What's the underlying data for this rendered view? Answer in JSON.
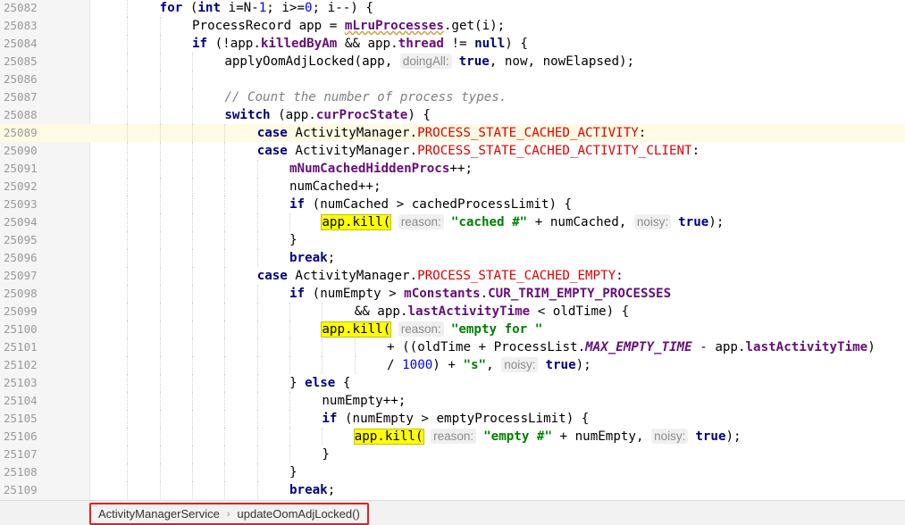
{
  "editor": {
    "current_line": "25089",
    "lines": [
      {
        "n": "25082",
        "indent": 2,
        "segs": [
          {
            "c": "kw",
            "t": "for"
          },
          {
            "t": " ("
          },
          {
            "c": "kw",
            "t": "int"
          },
          {
            "t": " i=N-"
          },
          {
            "c": "num",
            "t": "1"
          },
          {
            "t": "; i>="
          },
          {
            "c": "num",
            "t": "0"
          },
          {
            "t": "; i--) {"
          }
        ]
      },
      {
        "n": "25083",
        "indent": 3,
        "segs": [
          {
            "t": "ProcessRecord app = "
          },
          {
            "c": "fld uline",
            "t": "mLruProcesses"
          },
          {
            "t": ".get(i);"
          }
        ]
      },
      {
        "n": "25084",
        "indent": 3,
        "segs": [
          {
            "c": "kw",
            "t": "if"
          },
          {
            "t": " (!app."
          },
          {
            "c": "fld",
            "t": "killedByAm"
          },
          {
            "t": " && app."
          },
          {
            "c": "fld",
            "t": "thread"
          },
          {
            "t": " != "
          },
          {
            "c": "kw",
            "t": "null"
          },
          {
            "t": ") {"
          }
        ]
      },
      {
        "n": "25085",
        "indent": 4,
        "segs": [
          {
            "t": "applyOomAdjLocked(app, "
          },
          {
            "c": "hint",
            "t": "doingAll:"
          },
          {
            "c": "kw",
            "t": "true"
          },
          {
            "t": ", now, nowElapsed);"
          }
        ]
      },
      {
        "n": "25086",
        "indent": 4,
        "segs": []
      },
      {
        "n": "25087",
        "indent": 4,
        "segs": [
          {
            "c": "cmt",
            "t": "// Count the number of process types."
          }
        ]
      },
      {
        "n": "25088",
        "indent": 4,
        "segs": [
          {
            "c": "kw",
            "t": "switch"
          },
          {
            "t": " (app."
          },
          {
            "c": "fld",
            "t": "curProcState"
          },
          {
            "t": ") {"
          }
        ]
      },
      {
        "n": "25089",
        "indent": 5,
        "segs": [
          {
            "c": "kw",
            "t": "case"
          },
          {
            "t": " ActivityManager."
          },
          {
            "c": "cst",
            "t": "PROCESS_STATE_CACHED_ACTIVITY"
          },
          {
            "t": ":"
          }
        ]
      },
      {
        "n": "25090",
        "indent": 5,
        "segs": [
          {
            "c": "kw",
            "t": "case"
          },
          {
            "t": " ActivityManager."
          },
          {
            "c": "cst",
            "t": "PROCESS_STATE_CACHED_ACTIVITY_CLIENT"
          },
          {
            "t": ":"
          }
        ]
      },
      {
        "n": "25091",
        "indent": 6,
        "segs": [
          {
            "c": "fld",
            "t": "mNumCachedHiddenProcs"
          },
          {
            "t": "++;"
          }
        ]
      },
      {
        "n": "25092",
        "indent": 6,
        "segs": [
          {
            "t": "numCached++;"
          }
        ]
      },
      {
        "n": "25093",
        "indent": 6,
        "segs": [
          {
            "c": "kw",
            "t": "if"
          },
          {
            "t": " (numCached > cachedProcessLimit) {"
          }
        ]
      },
      {
        "n": "25094",
        "indent": 7,
        "segs": [
          {
            "c": "hl",
            "t": "app.kill("
          },
          {
            "t": " "
          },
          {
            "c": "hint",
            "t": "reason:"
          },
          {
            "c": "str",
            "t": "\"cached #\""
          },
          {
            "t": " + numCached, "
          },
          {
            "c": "hint",
            "t": "noisy:"
          },
          {
            "c": "kw",
            "t": "true"
          },
          {
            "t": ");"
          }
        ]
      },
      {
        "n": "25095",
        "indent": 6,
        "segs": [
          {
            "t": "}"
          }
        ]
      },
      {
        "n": "25096",
        "indent": 6,
        "segs": [
          {
            "c": "kw",
            "t": "break"
          },
          {
            "t": ";"
          }
        ]
      },
      {
        "n": "25097",
        "indent": 5,
        "segs": [
          {
            "c": "kw",
            "t": "case"
          },
          {
            "t": " ActivityManager."
          },
          {
            "c": "cst",
            "t": "PROCESS_STATE_CACHED_EMPTY"
          },
          {
            "t": ":"
          }
        ]
      },
      {
        "n": "25098",
        "indent": 6,
        "segs": [
          {
            "c": "kw",
            "t": "if"
          },
          {
            "t": " (numEmpty > "
          },
          {
            "c": "fld",
            "t": "mConstants"
          },
          {
            "t": "."
          },
          {
            "c": "fld",
            "t": "CUR_TRIM_EMPTY_PROCESSES"
          }
        ]
      },
      {
        "n": "25099",
        "indent": 8,
        "segs": [
          {
            "t": "&& app."
          },
          {
            "c": "fld",
            "t": "lastActivityTime"
          },
          {
            "t": " < oldTime) {"
          }
        ]
      },
      {
        "n": "25100",
        "indent": 7,
        "segs": [
          {
            "c": "hl",
            "t": "app.kill("
          },
          {
            "t": " "
          },
          {
            "c": "hint",
            "t": "reason:"
          },
          {
            "c": "str",
            "t": "\"empty for \""
          }
        ]
      },
      {
        "n": "25101",
        "indent": 9,
        "segs": [
          {
            "t": "+ ((oldTime + ProcessList."
          },
          {
            "c": "static-fld",
            "t": "MAX_EMPTY_TIME"
          },
          {
            "t": " - app."
          },
          {
            "c": "fld",
            "t": "lastActivityTime"
          },
          {
            "t": ")"
          }
        ]
      },
      {
        "n": "25102",
        "indent": 9,
        "segs": [
          {
            "t": "/ "
          },
          {
            "c": "num",
            "t": "1000"
          },
          {
            "t": ") + "
          },
          {
            "c": "str",
            "t": "\"s\""
          },
          {
            "t": ", "
          },
          {
            "c": "hint",
            "t": "noisy:"
          },
          {
            "c": "kw",
            "t": "true"
          },
          {
            "t": ");"
          }
        ]
      },
      {
        "n": "25103",
        "indent": 6,
        "segs": [
          {
            "t": "} "
          },
          {
            "c": "kw",
            "t": "else"
          },
          {
            "t": " {"
          }
        ]
      },
      {
        "n": "25104",
        "indent": 7,
        "segs": [
          {
            "t": "numEmpty++;"
          }
        ]
      },
      {
        "n": "25105",
        "indent": 7,
        "segs": [
          {
            "c": "kw",
            "t": "if"
          },
          {
            "t": " (numEmpty > emptyProcessLimit) {"
          }
        ]
      },
      {
        "n": "25106",
        "indent": 8,
        "segs": [
          {
            "c": "hl",
            "t": "app.kill("
          },
          {
            "t": " "
          },
          {
            "c": "hint",
            "t": "reason:"
          },
          {
            "c": "str",
            "t": "\"empty #\""
          },
          {
            "t": " + numEmpty, "
          },
          {
            "c": "hint",
            "t": "noisy:"
          },
          {
            "c": "kw",
            "t": "true"
          },
          {
            "t": ");"
          }
        ]
      },
      {
        "n": "25107",
        "indent": 7,
        "segs": [
          {
            "t": "}"
          }
        ]
      },
      {
        "n": "25108",
        "indent": 6,
        "segs": [
          {
            "t": "}"
          }
        ]
      },
      {
        "n": "25109",
        "indent": 6,
        "segs": [
          {
            "c": "kw",
            "t": "break"
          },
          {
            "t": ";"
          }
        ]
      }
    ]
  },
  "breadcrumb": {
    "class_name": "ActivityManagerService",
    "separator_icon": "chevron-right-icon",
    "separator_glyph": "›",
    "method_name": "updateOomAdjLocked()",
    "highlight_color": "#e02020"
  }
}
